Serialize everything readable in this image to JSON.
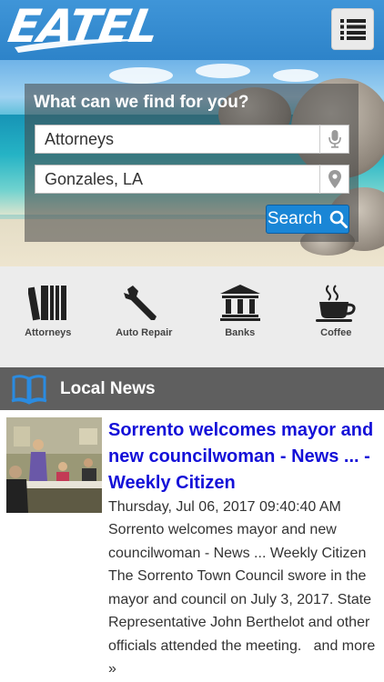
{
  "header": {
    "logo_text": "EATEL",
    "menu_icon": "list-icon"
  },
  "search": {
    "title": "What can we find for you?",
    "what_value": "Attorneys",
    "what_icon": "microphone-icon",
    "where_value": "Gonzales, LA",
    "where_icon": "location-pin-icon",
    "button_label": "Search",
    "button_icon": "search-icon"
  },
  "categories": [
    {
      "label": "Attorneys",
      "icon": "books-icon"
    },
    {
      "label": "Auto Repair",
      "icon": "wrench-icon"
    },
    {
      "label": "Banks",
      "icon": "bank-icon"
    },
    {
      "label": "Coffee",
      "icon": "coffee-cup-icon"
    }
  ],
  "news": {
    "section_title": "Local News",
    "section_icon": "open-book-icon",
    "article": {
      "title": "Sorrento welcomes mayor and new councilwoman - News ... - Weekly Citizen",
      "date": "Thursday, Jul 06, 2017 09:40:40 AM",
      "body": "Sorrento welcomes mayor and new councilwoman - News ... Weekly Citizen   The Sorrento Town Council swore in the mayor and council on July 3, 2017. State Representative John Berthelot and other officials attended the meeting.",
      "more_label": "and more »"
    }
  },
  "colors": {
    "header_blue": "#2d83c9",
    "button_blue": "#1a86d6",
    "link_blue": "#1410d8",
    "news_bar": "#5f5f5f"
  }
}
